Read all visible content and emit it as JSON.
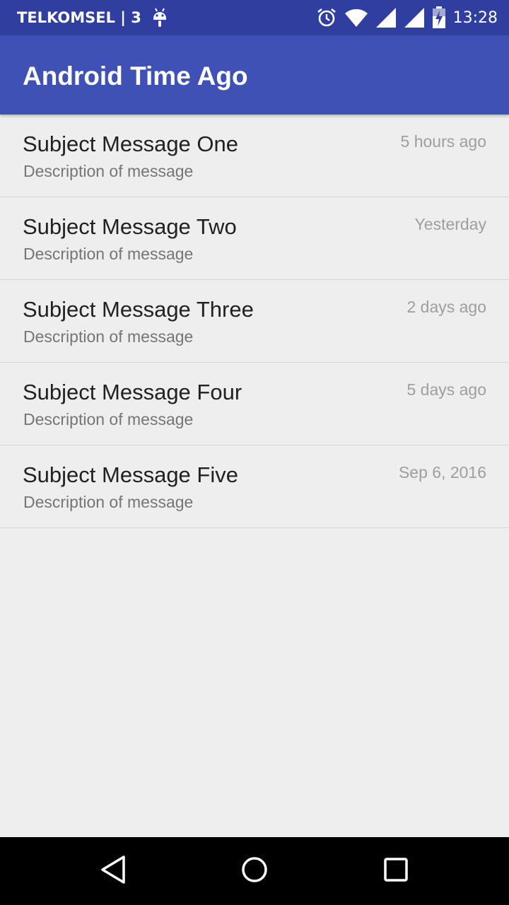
{
  "status_bar": {
    "carrier": "TELKOMSEL | 3",
    "time": "13:28",
    "icons": [
      "android-debug-icon",
      "alarm-icon",
      "wifi-icon",
      "signal-icon",
      "signal-icon",
      "battery-charging-icon"
    ]
  },
  "app_bar": {
    "title": "Android Time Ago"
  },
  "messages": [
    {
      "subject": "Subject Message One",
      "description": "Description of message",
      "time": "5 hours ago"
    },
    {
      "subject": "Subject Message Two",
      "description": "Description of message",
      "time": "Yesterday"
    },
    {
      "subject": "Subject Message Three",
      "description": "Description of message",
      "time": "2 days ago"
    },
    {
      "subject": "Subject Message Four",
      "description": "Description of message",
      "time": "5 days ago"
    },
    {
      "subject": "Subject Message Five",
      "description": "Description of message",
      "time": "Sep 6, 2016"
    }
  ],
  "nav_bar": {
    "buttons": [
      "back-icon",
      "home-icon",
      "recents-icon"
    ]
  },
  "colors": {
    "status_bar": "#303f9f",
    "app_bar": "#3f51b5",
    "background": "#eeeeee"
  }
}
